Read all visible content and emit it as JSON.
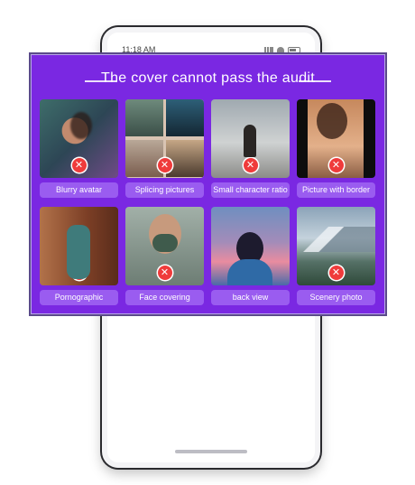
{
  "status_bar": {
    "time": "11:18 AM"
  },
  "panel": {
    "title": "The cover cannot pass the audit",
    "reject_symbol": "✕",
    "items": [
      {
        "label": "Blurry avatar",
        "icon": "reject-icon"
      },
      {
        "label": "Splicing pictures",
        "icon": "reject-icon"
      },
      {
        "label": "Small character ratio",
        "icon": "reject-icon"
      },
      {
        "label": "Picture with border",
        "icon": "reject-icon"
      },
      {
        "label": "Pornographic",
        "icon": "reject-icon"
      },
      {
        "label": "Face covering",
        "icon": "reject-icon"
      },
      {
        "label": "back view",
        "icon": "reject-icon"
      },
      {
        "label": "Scenery photo",
        "icon": "reject-icon"
      }
    ]
  },
  "colors": {
    "panel_bg": "#7a28e2",
    "label_bg": "#9a5cf0",
    "reject_red": "#ef3b3b"
  }
}
